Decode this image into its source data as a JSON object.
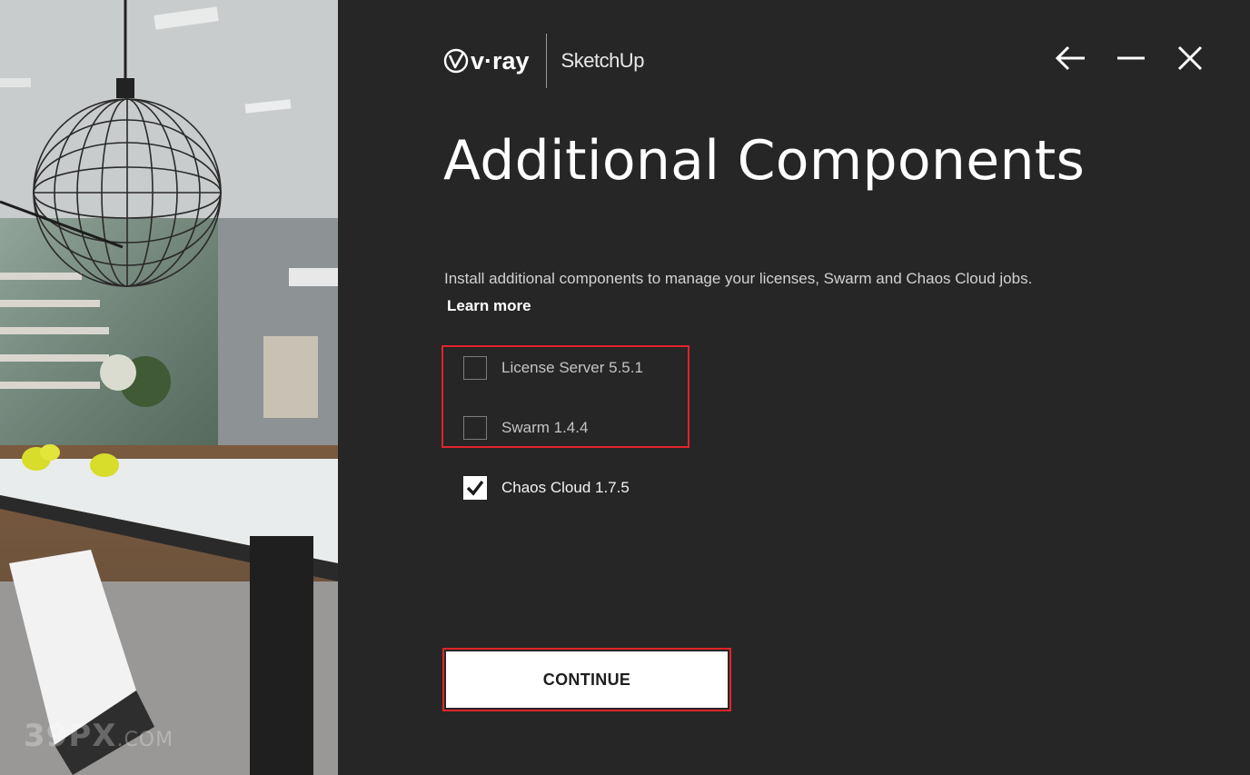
{
  "brand": {
    "product_logo_text": "v·ray",
    "host_app": "SketchUp"
  },
  "window_controls": {
    "back_icon": "arrow-left-icon",
    "minimize_icon": "minus-icon",
    "close_icon": "close-icon"
  },
  "page": {
    "title": "Additional Components",
    "description": "Install additional components to manage your licenses, Swarm and Chaos Cloud jobs.",
    "learn_more": "Learn more"
  },
  "components": [
    {
      "label": "License Server 5.5.1",
      "checked": false
    },
    {
      "label": "Swarm 1.4.4",
      "checked": false
    },
    {
      "label": "Chaos Cloud 1.7.5",
      "checked": true
    }
  ],
  "actions": {
    "continue_label": "CONTINUE"
  },
  "photo": {
    "watermark": "39PX",
    "watermark_suffix": ".COM"
  },
  "colors": {
    "background": "#262626",
    "accent_outline": "#e0242a",
    "text": "#ffffff"
  }
}
